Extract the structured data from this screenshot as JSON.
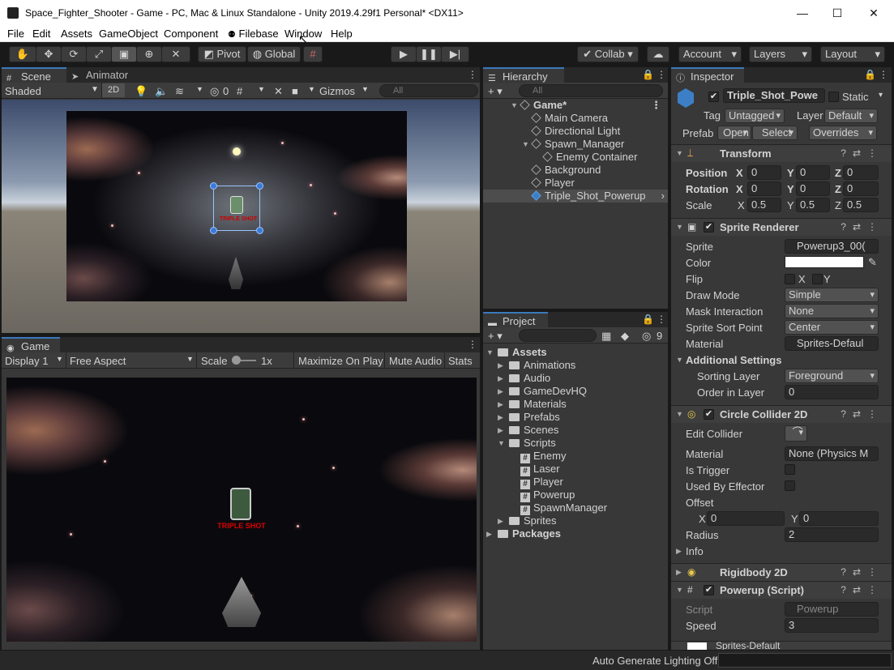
{
  "window": {
    "title": "Space_Fighter_Shooter - Game - PC, Mac & Linux Standalone - Unity 2019.4.29f1 Personal* <DX11>",
    "minimize": "—",
    "maximize": "☐",
    "close": "✕"
  },
  "menu": [
    "File",
    "Edit",
    "Assets",
    "GameObject",
    "Component",
    "Filebase",
    "Window",
    "Help"
  ],
  "toolbar": {
    "pivot": "Pivot",
    "global": "Global",
    "collab": "Collab",
    "account": "Account",
    "layers": "Layers",
    "layout": "Layout"
  },
  "scene": {
    "tabs": [
      "Scene",
      "Animator"
    ],
    "shading": "Shaded",
    "mode2d": "2D",
    "hidden_count": "0",
    "gizmos": "Gizmos",
    "search_placeholder": "All",
    "selection_label": "TRIPLE SHOT"
  },
  "game": {
    "tab": "Game",
    "display": "Display 1",
    "aspect": "Free Aspect",
    "scale_label": "Scale",
    "scale_value": "1x",
    "maximize": "Maximize On Play",
    "mute": "Mute Audio",
    "stats": "Stats",
    "powerup_label": "TRIPLE SHOT"
  },
  "hierarchy": {
    "tab": "Hierarchy",
    "search_placeholder": "All",
    "items": [
      {
        "label": "Game*"
      },
      {
        "label": "Main Camera"
      },
      {
        "label": "Directional Light"
      },
      {
        "label": "Spawn_Manager"
      },
      {
        "label": "Enemy Container"
      },
      {
        "label": "Background"
      },
      {
        "label": "Player"
      },
      {
        "label": "Triple_Shot_Powerup"
      }
    ]
  },
  "project": {
    "tab": "Project",
    "hidden_count": "9",
    "items": [
      {
        "label": "Assets"
      },
      {
        "label": "Animations"
      },
      {
        "label": "Audio"
      },
      {
        "label": "GameDevHQ"
      },
      {
        "label": "Materials"
      },
      {
        "label": "Prefabs"
      },
      {
        "label": "Scenes"
      },
      {
        "label": "Scripts"
      },
      {
        "label": "Enemy"
      },
      {
        "label": "Laser"
      },
      {
        "label": "Player"
      },
      {
        "label": "Powerup"
      },
      {
        "label": "SpawnManager"
      },
      {
        "label": "Sprites"
      },
      {
        "label": "Packages"
      }
    ]
  },
  "inspector": {
    "tab": "Inspector",
    "object_name": "Triple_Shot_Powe",
    "static_label": "Static",
    "tag_label": "Tag",
    "tag_value": "Untagged",
    "layer_label": "Layer",
    "layer_value": "Default",
    "prefab_label": "Prefab",
    "open": "Open",
    "select": "Select",
    "overrides": "Overrides",
    "transform": {
      "title": "Transform",
      "position_label": "Position",
      "rotation_label": "Rotation",
      "scale_label": "Scale",
      "x": "X",
      "y": "Y",
      "z": "Z",
      "position": [
        "0",
        "0",
        "0"
      ],
      "rotation": [
        "0",
        "0",
        "0"
      ],
      "scale": [
        "0.5",
        "0.5",
        "0.5"
      ]
    },
    "sprite_renderer": {
      "title": "Sprite Renderer",
      "sprite_label": "Sprite",
      "sprite_value": "Powerup3_00(",
      "color_label": "Color",
      "color_value": "#ffffff",
      "flip_label": "Flip",
      "flip_x": "X",
      "flip_y": "Y",
      "draw_mode_label": "Draw Mode",
      "draw_mode_value": "Simple",
      "mask_label": "Mask Interaction",
      "mask_value": "None",
      "sort_point_label": "Sprite Sort Point",
      "sort_point_value": "Center",
      "material_label": "Material",
      "material_value": "Sprites-Defaul",
      "additional": "Additional Settings",
      "sorting_layer_label": "Sorting Layer",
      "sorting_layer_value": "Foreground",
      "order_label": "Order in Layer",
      "order_value": "0"
    },
    "circle_collider": {
      "title": "Circle Collider 2D",
      "edit_label": "Edit Collider",
      "material_label": "Material",
      "material_value": "None (Physics M",
      "trigger_label": "Is Trigger",
      "effector_label": "Used By Effector",
      "offset_label": "Offset",
      "x": "X",
      "y": "Y",
      "offset_x": "0",
      "offset_y": "0",
      "radius_label": "Radius",
      "radius_value": "2",
      "info_label": "Info"
    },
    "rigidbody": {
      "title": "Rigidbody 2D"
    },
    "powerup_script": {
      "title": "Powerup (Script)",
      "script_label": "Script",
      "script_value": "Powerup",
      "speed_label": "Speed",
      "speed_value": "3"
    },
    "bottom_material": "Sprites-Default"
  },
  "status": {
    "text": "Auto Generate Lighting Off"
  }
}
